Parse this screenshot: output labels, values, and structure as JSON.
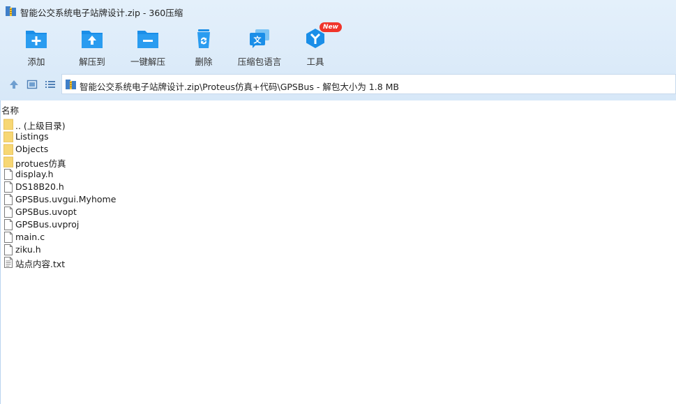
{
  "window": {
    "title": "智能公交系统电子站牌设计.zip - 360压缩"
  },
  "toolbar": {
    "items": [
      {
        "label": "添加",
        "icon": "add-icon"
      },
      {
        "label": "解压到",
        "icon": "extract-to-icon"
      },
      {
        "label": "一键解压",
        "icon": "one-click-extract-icon"
      },
      {
        "label": "删除",
        "icon": "delete-icon"
      },
      {
        "label": "压缩包语言",
        "icon": "archive-language-icon"
      },
      {
        "label": "工具",
        "icon": "tools-icon",
        "badge": "New"
      }
    ]
  },
  "address": {
    "path": "智能公交系统电子站牌设计.zip\\Proteus仿真+代码\\GPSBus - 解包大小为 1.8 MB"
  },
  "file_list": {
    "column_name": "名称",
    "rows": [
      {
        "name": ".. (上级目录)",
        "type": "folder"
      },
      {
        "name": "Listings",
        "type": "folder"
      },
      {
        "name": "Objects",
        "type": "folder"
      },
      {
        "name": "protues仿真",
        "type": "folder"
      },
      {
        "name": "display.h",
        "type": "file"
      },
      {
        "name": "DS18B20.h",
        "type": "file"
      },
      {
        "name": "GPSBus.uvgui.Myhome",
        "type": "file"
      },
      {
        "name": "GPSBus.uvopt",
        "type": "file"
      },
      {
        "name": "GPSBus.uvproj",
        "type": "file"
      },
      {
        "name": "main.c",
        "type": "file"
      },
      {
        "name": "ziku.h",
        "type": "file"
      },
      {
        "name": "站点内容.txt",
        "type": "text"
      }
    ]
  },
  "colors": {
    "toolbar_blue": "#1a8ee8",
    "folder": "#f7d774",
    "badge_red": "#f0352a"
  }
}
